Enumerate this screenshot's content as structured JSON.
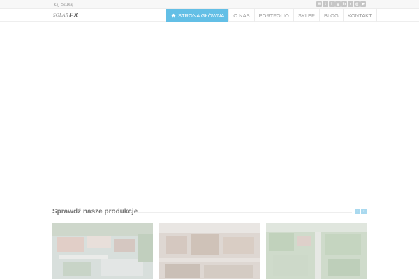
{
  "search": {
    "placeholder": "Szukaj"
  },
  "social": [
    {
      "icon": "email-icon",
      "glyph": "✉"
    },
    {
      "icon": "twitter-icon",
      "glyph": "t"
    },
    {
      "icon": "facebook-icon",
      "glyph": "f"
    },
    {
      "icon": "google-plus-icon",
      "glyph": "g"
    },
    {
      "icon": "linkedin-icon",
      "glyph": "in"
    },
    {
      "icon": "vimeo-icon",
      "glyph": "v"
    },
    {
      "icon": "instagram-icon",
      "glyph": "◎"
    },
    {
      "icon": "youtube-icon",
      "glyph": "▶"
    }
  ],
  "logo": {
    "text": "SOLAR",
    "mark": "FX"
  },
  "nav": [
    {
      "label": "STRONA GŁÓWNA",
      "active": true
    },
    {
      "label": "O NAS",
      "active": false
    },
    {
      "label": "PORTFOLIO",
      "active": false
    },
    {
      "label": "SKLEP",
      "active": false
    },
    {
      "label": "BLOG",
      "active": false
    },
    {
      "label": "KONTAKT",
      "active": false
    }
  ],
  "productions": {
    "title": "Sprawdź nasze produkcje",
    "prev_glyph": "‹",
    "next_glyph": "›"
  },
  "colors": {
    "accent": "#63bfe6",
    "arrow": "#a9d9ef"
  }
}
